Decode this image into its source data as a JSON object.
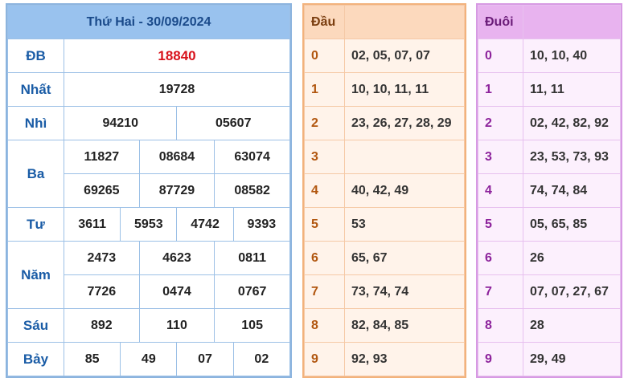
{
  "results": {
    "title": "Thứ Hai - 30/09/2024",
    "rows": [
      {
        "label": "ĐB",
        "values": [
          "18840"
        ]
      },
      {
        "label": "Nhất",
        "values": [
          "19728"
        ]
      },
      {
        "label": "Nhì",
        "values": [
          "94210",
          "05607"
        ]
      },
      {
        "label": "Ba",
        "values": [
          "11827",
          "08684",
          "63074",
          "69265",
          "87729",
          "08582"
        ]
      },
      {
        "label": "Tư",
        "values": [
          "3611",
          "5953",
          "4742",
          "9393"
        ]
      },
      {
        "label": "Năm",
        "values": [
          "2473",
          "4623",
          "0811",
          "7726",
          "0474",
          "0767"
        ]
      },
      {
        "label": "Sáu",
        "values": [
          "892",
          "110",
          "105"
        ]
      },
      {
        "label": "Bảy",
        "values": [
          "85",
          "49",
          "07",
          "02"
        ]
      }
    ]
  },
  "dau": {
    "header": "Đầu",
    "rows": [
      {
        "key": "0",
        "value": "02, 05, 07, 07"
      },
      {
        "key": "1",
        "value": "10, 10, 11, 11"
      },
      {
        "key": "2",
        "value": "23, 26, 27, 28, 29"
      },
      {
        "key": "3",
        "value": ""
      },
      {
        "key": "4",
        "value": "40, 42, 49"
      },
      {
        "key": "5",
        "value": "53"
      },
      {
        "key": "6",
        "value": "65, 67"
      },
      {
        "key": "7",
        "value": "73, 74, 74"
      },
      {
        "key": "8",
        "value": "82, 84, 85"
      },
      {
        "key": "9",
        "value": "92, 93"
      }
    ]
  },
  "duoi": {
    "header": "Đuôi",
    "rows": [
      {
        "key": "0",
        "value": "10, 10, 40"
      },
      {
        "key": "1",
        "value": "11, 11"
      },
      {
        "key": "2",
        "value": "02, 42, 82, 92"
      },
      {
        "key": "3",
        "value": "23, 53, 73, 93"
      },
      {
        "key": "4",
        "value": "74, 74, 84"
      },
      {
        "key": "5",
        "value": "05, 65, 85"
      },
      {
        "key": "6",
        "value": "26"
      },
      {
        "key": "7",
        "value": "07, 07, 27, 67"
      },
      {
        "key": "8",
        "value": "28"
      },
      {
        "key": "9",
        "value": "29, 49"
      }
    ]
  },
  "colors": {
    "special_prize": "#d8121b",
    "label_blue": "#1a5ca6",
    "dau_accent": "#b1560f",
    "duoi_accent": "#8d239c"
  }
}
